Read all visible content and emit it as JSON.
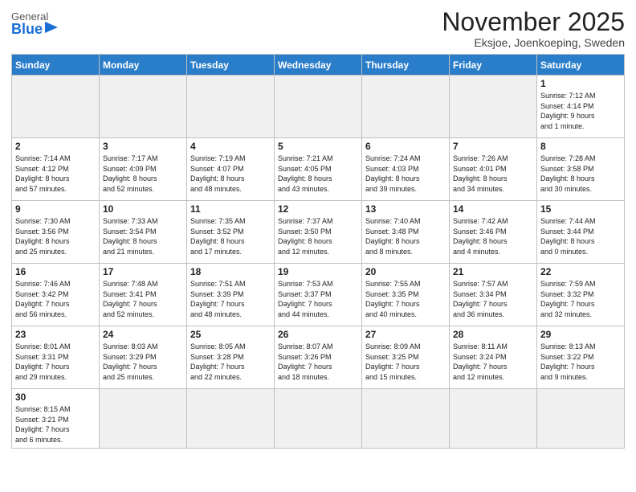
{
  "header": {
    "logo_general": "General",
    "logo_blue": "Blue",
    "title": "November 2025",
    "subtitle": "Eksjoe, Joenkoeping, Sweden"
  },
  "days_of_week": [
    "Sunday",
    "Monday",
    "Tuesday",
    "Wednesday",
    "Thursday",
    "Friday",
    "Saturday"
  ],
  "weeks": [
    [
      {
        "day": "",
        "info": ""
      },
      {
        "day": "",
        "info": ""
      },
      {
        "day": "",
        "info": ""
      },
      {
        "day": "",
        "info": ""
      },
      {
        "day": "",
        "info": ""
      },
      {
        "day": "",
        "info": ""
      },
      {
        "day": "1",
        "info": "Sunrise: 7:12 AM\nSunset: 4:14 PM\nDaylight: 9 hours\nand 1 minute."
      }
    ],
    [
      {
        "day": "2",
        "info": "Sunrise: 7:14 AM\nSunset: 4:12 PM\nDaylight: 8 hours\nand 57 minutes."
      },
      {
        "day": "3",
        "info": "Sunrise: 7:17 AM\nSunset: 4:09 PM\nDaylight: 8 hours\nand 52 minutes."
      },
      {
        "day": "4",
        "info": "Sunrise: 7:19 AM\nSunset: 4:07 PM\nDaylight: 8 hours\nand 48 minutes."
      },
      {
        "day": "5",
        "info": "Sunrise: 7:21 AM\nSunset: 4:05 PM\nDaylight: 8 hours\nand 43 minutes."
      },
      {
        "day": "6",
        "info": "Sunrise: 7:24 AM\nSunset: 4:03 PM\nDaylight: 8 hours\nand 39 minutes."
      },
      {
        "day": "7",
        "info": "Sunrise: 7:26 AM\nSunset: 4:01 PM\nDaylight: 8 hours\nand 34 minutes."
      },
      {
        "day": "8",
        "info": "Sunrise: 7:28 AM\nSunset: 3:58 PM\nDaylight: 8 hours\nand 30 minutes."
      }
    ],
    [
      {
        "day": "9",
        "info": "Sunrise: 7:30 AM\nSunset: 3:56 PM\nDaylight: 8 hours\nand 25 minutes."
      },
      {
        "day": "10",
        "info": "Sunrise: 7:33 AM\nSunset: 3:54 PM\nDaylight: 8 hours\nand 21 minutes."
      },
      {
        "day": "11",
        "info": "Sunrise: 7:35 AM\nSunset: 3:52 PM\nDaylight: 8 hours\nand 17 minutes."
      },
      {
        "day": "12",
        "info": "Sunrise: 7:37 AM\nSunset: 3:50 PM\nDaylight: 8 hours\nand 12 minutes."
      },
      {
        "day": "13",
        "info": "Sunrise: 7:40 AM\nSunset: 3:48 PM\nDaylight: 8 hours\nand 8 minutes."
      },
      {
        "day": "14",
        "info": "Sunrise: 7:42 AM\nSunset: 3:46 PM\nDaylight: 8 hours\nand 4 minutes."
      },
      {
        "day": "15",
        "info": "Sunrise: 7:44 AM\nSunset: 3:44 PM\nDaylight: 8 hours\nand 0 minutes."
      }
    ],
    [
      {
        "day": "16",
        "info": "Sunrise: 7:46 AM\nSunset: 3:42 PM\nDaylight: 7 hours\nand 56 minutes."
      },
      {
        "day": "17",
        "info": "Sunrise: 7:48 AM\nSunset: 3:41 PM\nDaylight: 7 hours\nand 52 minutes."
      },
      {
        "day": "18",
        "info": "Sunrise: 7:51 AM\nSunset: 3:39 PM\nDaylight: 7 hours\nand 48 minutes."
      },
      {
        "day": "19",
        "info": "Sunrise: 7:53 AM\nSunset: 3:37 PM\nDaylight: 7 hours\nand 44 minutes."
      },
      {
        "day": "20",
        "info": "Sunrise: 7:55 AM\nSunset: 3:35 PM\nDaylight: 7 hours\nand 40 minutes."
      },
      {
        "day": "21",
        "info": "Sunrise: 7:57 AM\nSunset: 3:34 PM\nDaylight: 7 hours\nand 36 minutes."
      },
      {
        "day": "22",
        "info": "Sunrise: 7:59 AM\nSunset: 3:32 PM\nDaylight: 7 hours\nand 32 minutes."
      }
    ],
    [
      {
        "day": "23",
        "info": "Sunrise: 8:01 AM\nSunset: 3:31 PM\nDaylight: 7 hours\nand 29 minutes."
      },
      {
        "day": "24",
        "info": "Sunrise: 8:03 AM\nSunset: 3:29 PM\nDaylight: 7 hours\nand 25 minutes."
      },
      {
        "day": "25",
        "info": "Sunrise: 8:05 AM\nSunset: 3:28 PM\nDaylight: 7 hours\nand 22 minutes."
      },
      {
        "day": "26",
        "info": "Sunrise: 8:07 AM\nSunset: 3:26 PM\nDaylight: 7 hours\nand 18 minutes."
      },
      {
        "day": "27",
        "info": "Sunrise: 8:09 AM\nSunset: 3:25 PM\nDaylight: 7 hours\nand 15 minutes."
      },
      {
        "day": "28",
        "info": "Sunrise: 8:11 AM\nSunset: 3:24 PM\nDaylight: 7 hours\nand 12 minutes."
      },
      {
        "day": "29",
        "info": "Sunrise: 8:13 AM\nSunset: 3:22 PM\nDaylight: 7 hours\nand 9 minutes."
      }
    ],
    [
      {
        "day": "30",
        "info": "Sunrise: 8:15 AM\nSunset: 3:21 PM\nDaylight: 7 hours\nand 6 minutes."
      },
      {
        "day": "",
        "info": ""
      },
      {
        "day": "",
        "info": ""
      },
      {
        "day": "",
        "info": ""
      },
      {
        "day": "",
        "info": ""
      },
      {
        "day": "",
        "info": ""
      },
      {
        "day": "",
        "info": ""
      }
    ]
  ]
}
